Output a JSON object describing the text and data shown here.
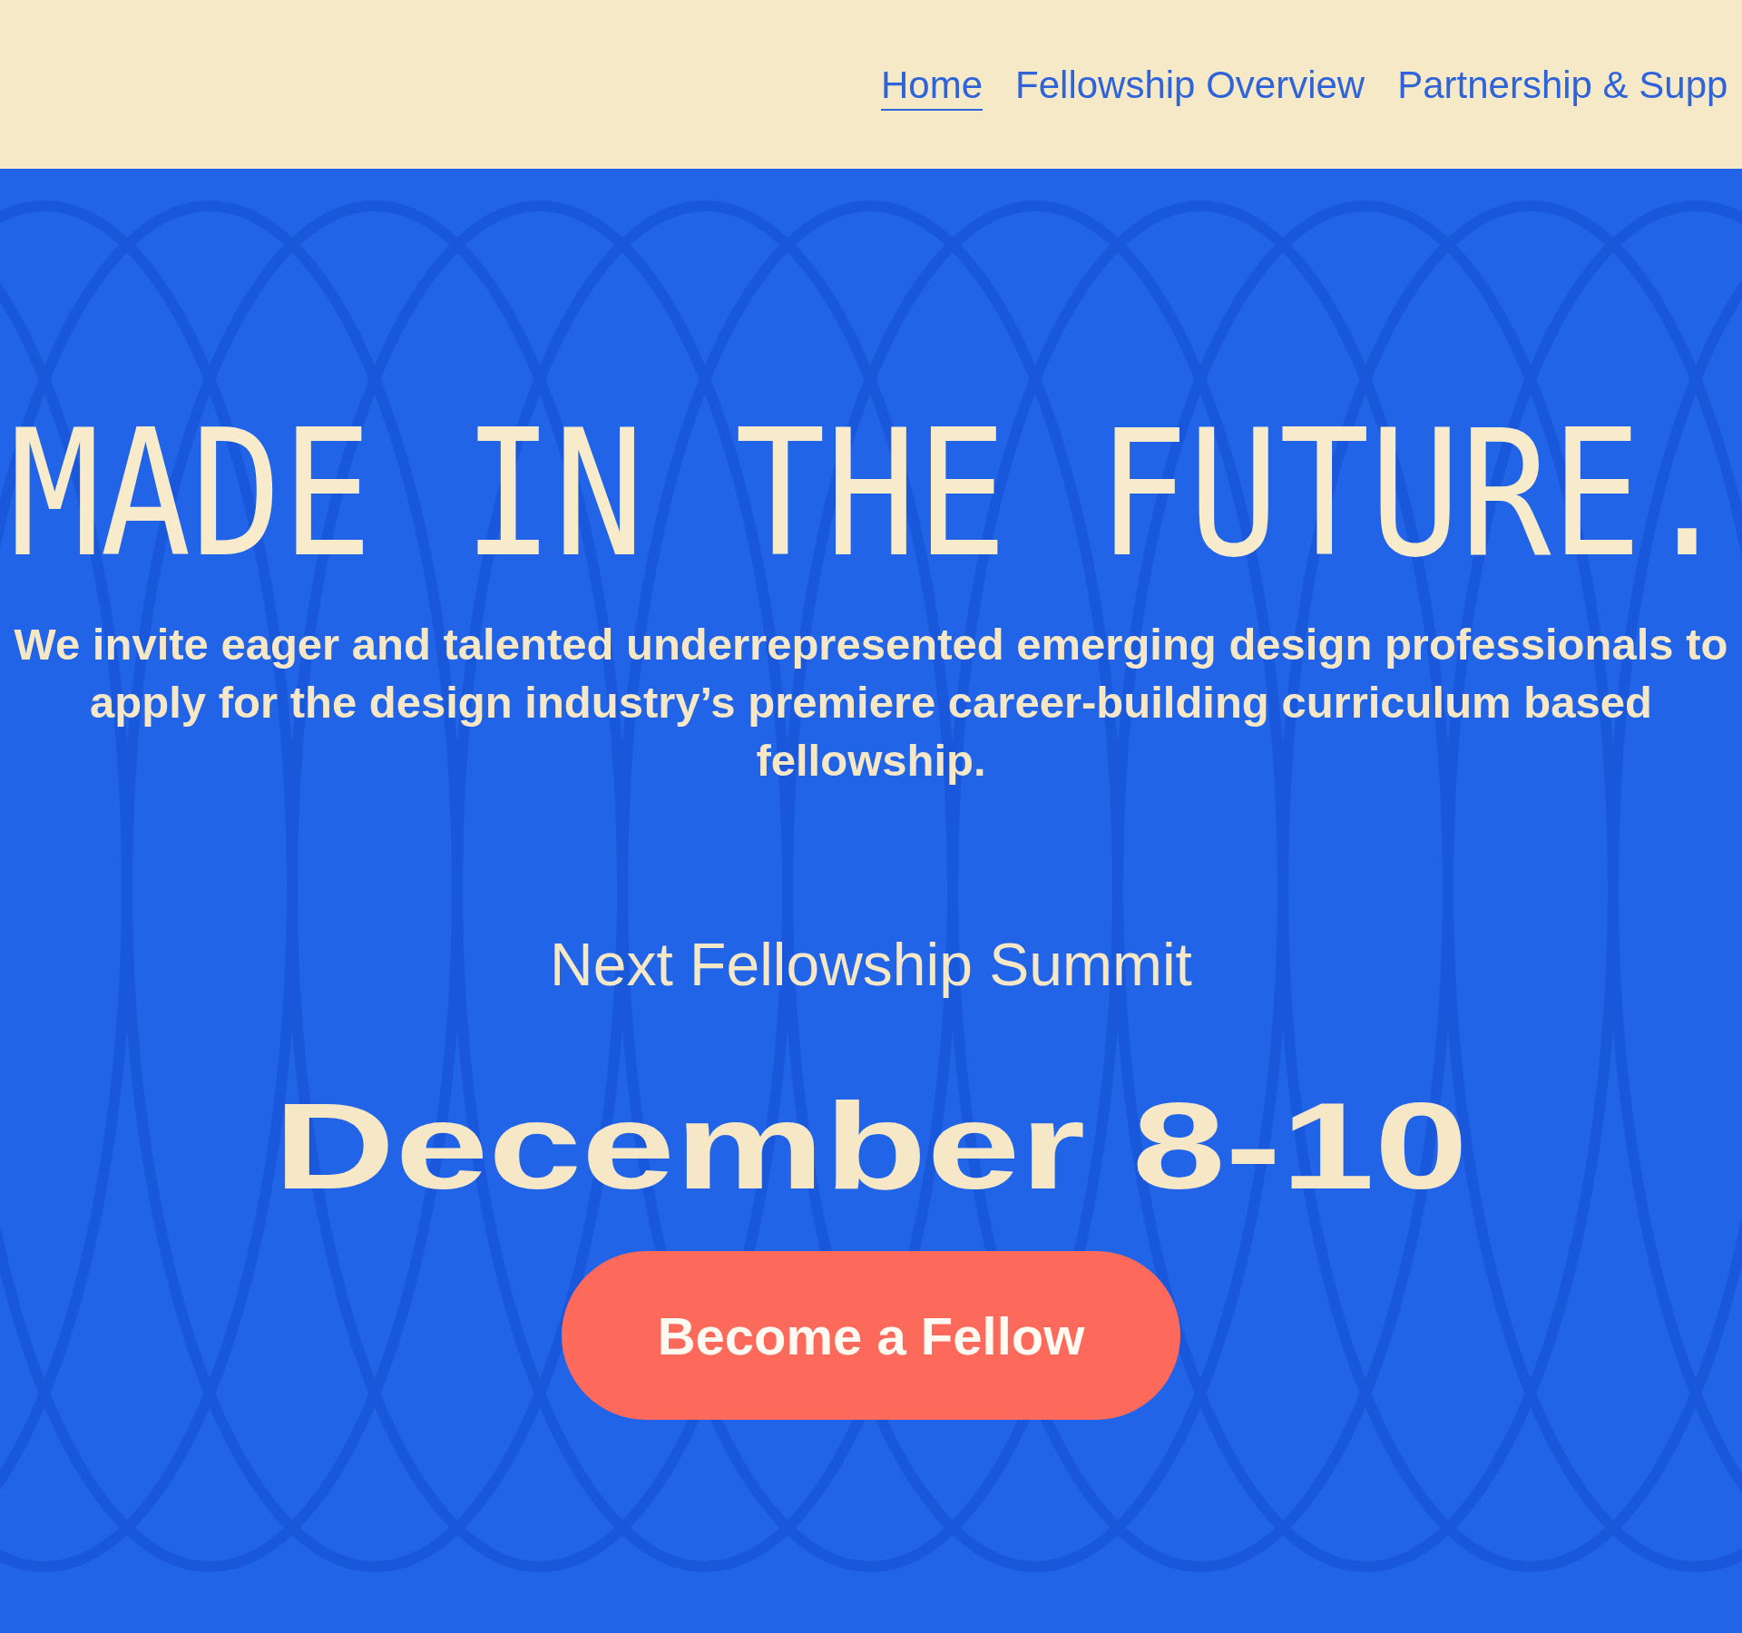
{
  "header": {
    "nav": [
      {
        "label": "Home",
        "selected": true
      },
      {
        "label": "Fellowship Overview",
        "selected": false
      },
      {
        "label": "Partnership & Supp",
        "selected": false
      }
    ]
  },
  "hero": {
    "headline": "MADE IN THE FUTURE.",
    "intro": "We invite eager and talented underrepresented emerging design professionals to apply for the design industry’s premiere career-building curriculum based fellowship.",
    "summit_label": "Next Fellowship Summit",
    "summit_date": "December 8-10",
    "cta": "Become a Fellow"
  }
}
